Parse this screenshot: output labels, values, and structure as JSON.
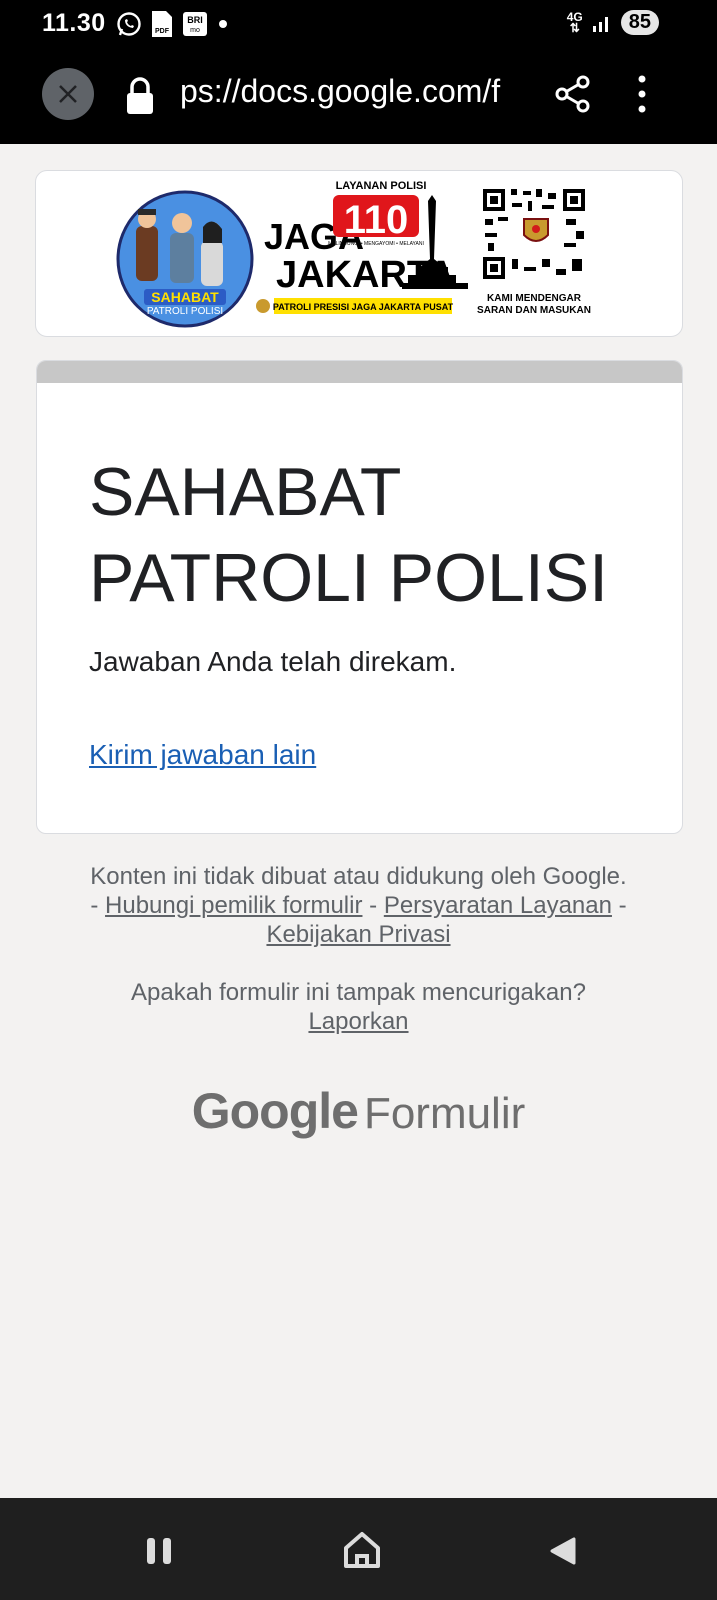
{
  "status_bar": {
    "time": "11.30",
    "network": "4G",
    "battery": "85",
    "pdf_label": "PDF",
    "bri_label": "BRI",
    "bri_sub": "mo"
  },
  "browser": {
    "url": "ps://docs.google.com/f"
  },
  "banner": {
    "sahabat_label": "SAHABAT",
    "patroli_polisi_label": "PATROLI POLISI",
    "layanan_label": "LAYANAN POLISI",
    "jaga_label": "JAGA",
    "number_label": "110",
    "motto": "MELINDUNGI • MENGAYOMI • MELAYANI",
    "jakarta_label": "JAKARTA",
    "plus_label": "+",
    "patrol_strip": "PATROLI PRESISI JAGA JAKARTA PUSAT",
    "qr_caption_1": "KAMI MENDENGAR",
    "qr_caption_2": "SARAN DAN MASUKAN"
  },
  "form": {
    "title": "SAHABAT PATROLI POLISI",
    "message": "Jawaban Anda telah direkam.",
    "another_link": "Kirim jawaban lain"
  },
  "footer": {
    "disclaimer": "Konten ini tidak dibuat atau didukung oleh Google.",
    "sep1": "-",
    "contact_link": "Hubungi pemilik formulir",
    "sep2": "-",
    "terms_link": "Persyaratan Layanan",
    "sep3": "-",
    "privacy_link": "Kebijakan Privasi",
    "suspicious_q": "Apakah formulir ini tampak mencurigakan?",
    "report_link": "Laporkan",
    "brand_google": "Google",
    "brand_forms": "Formulir"
  },
  "colors": {
    "link": "#1a5fb4",
    "banner_blue": "#4a90e2",
    "banner_red": "#e0161b",
    "banner_yellow": "#ffe000"
  }
}
